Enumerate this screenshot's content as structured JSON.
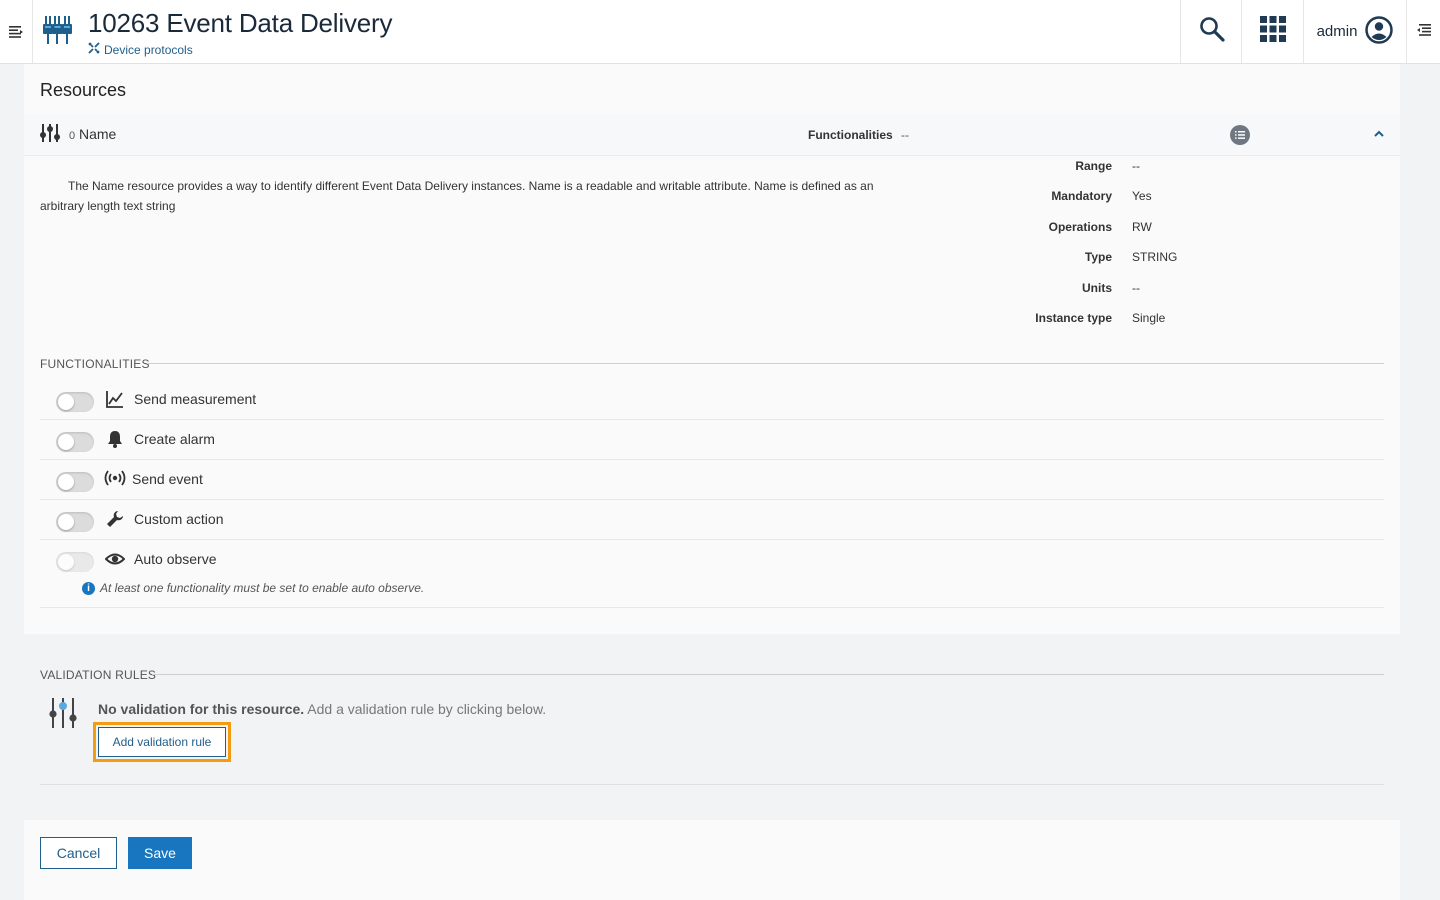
{
  "header": {
    "title": "10263 Event Data Delivery",
    "breadcrumb": "Device protocols",
    "user": "admin",
    "icons": {
      "menu": "menu-icon",
      "app": "device-protocols-icon",
      "breadcrumb": "protocols-icon",
      "search": "search-icon",
      "apps": "app-grid-icon",
      "user": "user-circle-icon",
      "right_drawer": "right-drawer-icon"
    }
  },
  "resources": {
    "title": "Resources",
    "item": {
      "id": "0",
      "name": "Name",
      "functionalities_label": "Functionalities",
      "functionalities_value": "--",
      "description": "The Name resource provides a way to identify different Event Data Delivery instances. Name is a readable and writable attribute. Name is defined as an arbitrary length text string",
      "properties": [
        {
          "key": "Range",
          "value": "--"
        },
        {
          "key": "Mandatory",
          "value": "Yes"
        },
        {
          "key": "Operations",
          "value": "RW"
        },
        {
          "key": "Type",
          "value": "STRING"
        },
        {
          "key": "Units",
          "value": "--"
        },
        {
          "key": "Instance type",
          "value": "Single"
        }
      ]
    }
  },
  "functionalities": {
    "section_label": "FUNCTIONALITIES",
    "items": [
      {
        "label": "Send measurement",
        "icon": "line-chart-icon",
        "enabled": false
      },
      {
        "label": "Create alarm",
        "icon": "bell-icon",
        "enabled": false
      },
      {
        "label": "Send event",
        "icon": "broadcast-icon",
        "enabled": false
      },
      {
        "label": "Custom action",
        "icon": "wrench-icon",
        "enabled": false
      },
      {
        "label": "Auto observe",
        "icon": "eye-icon",
        "enabled": false,
        "disabled": true
      }
    ],
    "note": "At least one functionality must be set to enable auto observe."
  },
  "validation": {
    "section_label": "VALIDATION RULES",
    "empty_bold": "No validation for this resource.",
    "empty_text": " Add a validation rule by clicking below.",
    "add_button": "Add validation rule"
  },
  "footer": {
    "cancel": "Cancel",
    "save": "Save"
  },
  "colors": {
    "primary": "#1776bf",
    "link": "#1f5f8b",
    "highlight": "#f39c12"
  }
}
